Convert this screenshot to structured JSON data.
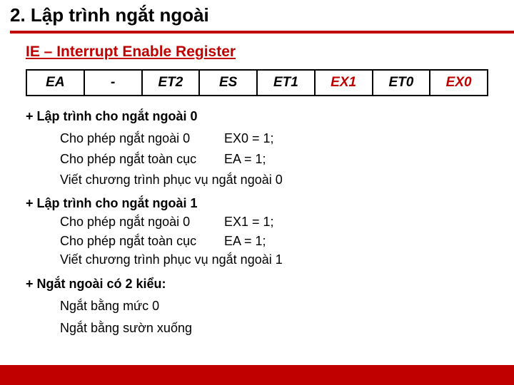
{
  "title": "2. Lập trình ngắt ngoài",
  "subheading": "IE – Interrupt Enable Register",
  "register": {
    "cells": [
      "EA",
      "-",
      "ET2",
      "ES",
      "ET1",
      "EX1",
      "ET0",
      "EX0"
    ]
  },
  "section0": {
    "title": "+ Lập trình cho ngắt ngoài 0",
    "lines": [
      {
        "left": "Cho phép ngắt ngoài 0",
        "right": "EX0 = 1;"
      },
      {
        "left": "Cho phép ngắt toàn cục",
        "right": "EA = 1;"
      }
    ],
    "final": "Viết chương trình phục vụ ngắt ngoài 0"
  },
  "section1": {
    "title": "+ Lập trình cho ngắt ngoài 1",
    "lines": [
      {
        "left": "Cho phép ngắt ngoài 0",
        "right": "EX1 = 1;"
      },
      {
        "left": "Cho phép ngắt toàn cục",
        "right": "EA = 1;"
      }
    ],
    "final": "Viết chương trình phục vụ ngắt ngoài 1"
  },
  "section2": {
    "title": "+ Ngắt ngoài có 2 kiểu:",
    "items": [
      "Ngắt bằng mức 0",
      "Ngắt bằng sườn xuống"
    ]
  }
}
